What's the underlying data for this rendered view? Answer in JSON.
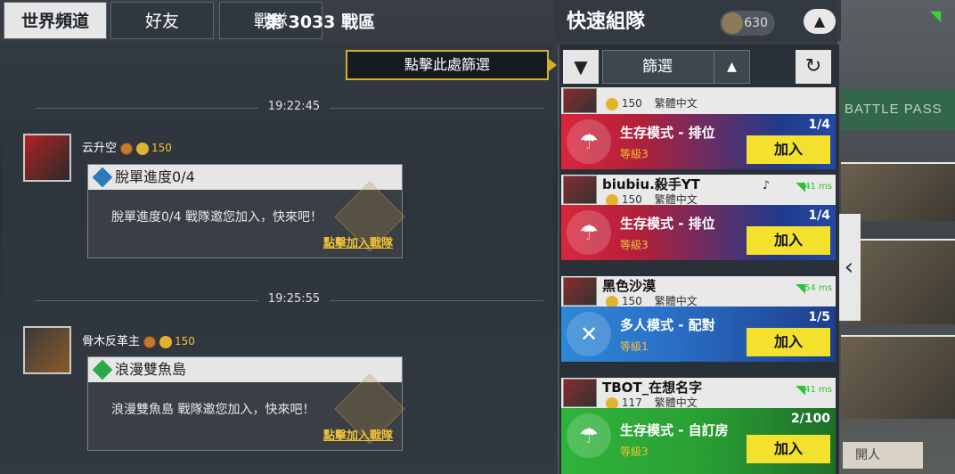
{
  "tabs": [
    {
      "label": "世界頻道",
      "active": true
    },
    {
      "label": "好友",
      "active": false
    },
    {
      "label": "戰隊",
      "active": false
    }
  ],
  "chat": {
    "channel_title": "第 3033 戰區",
    "tooltip": "點擊此處篩選",
    "messages": [
      {
        "time": "19:22:45",
        "user": "云升空",
        "points": "150",
        "card_title": "脫單進度0/4",
        "card_body": "脫單進度0/4 戰隊邀您加入，快來吧！",
        "card_link": "點擊加入戰隊"
      },
      {
        "time": "19:25:55",
        "user": "骨木反革主",
        "points": "150",
        "card_title": "浪漫雙魚島",
        "card_body": "浪漫雙魚島 戰隊邀您加入，快來吧！",
        "card_link": "點擊加入戰隊"
      }
    ]
  },
  "quick_team": {
    "title": "快速組隊",
    "coins": "630",
    "filter_label": "篩選",
    "icons": {
      "filter": "filter-icon",
      "refresh": "refresh-icon",
      "toggle": "chevron-up-icon"
    },
    "entries": [
      {
        "name": "",
        "points": "150",
        "lang": "繁體中文",
        "ping": "",
        "mode": "生存模式 - 排位",
        "level": "等級3",
        "count": "1/4",
        "join": "加入",
        "color": "red"
      },
      {
        "name": "biubiu.殺手YT",
        "points": "150",
        "lang": "繁體中文",
        "ping": "41 ms",
        "mode": "生存模式 - 排位",
        "level": "等級3",
        "count": "1/4",
        "join": "加入",
        "color": "red"
      },
      {
        "name": "黑色沙漠",
        "points": "150",
        "lang": "繁體中文",
        "ping": "54 ms",
        "mode": "多人模式 - 配對",
        "level": "等級1",
        "count": "1/5",
        "join": "加入",
        "color": "blue"
      },
      {
        "name": "TBOT_在想名字",
        "points": "117",
        "lang": "繁體中文",
        "ping": "41 ms",
        "mode": "生存模式 - 自訂房",
        "level": "等級3",
        "count": "2/100",
        "join": "加入",
        "color": "green"
      }
    ]
  },
  "background": {
    "battle_pass": "BATTLE PASS",
    "bottom_button": "開人"
  }
}
